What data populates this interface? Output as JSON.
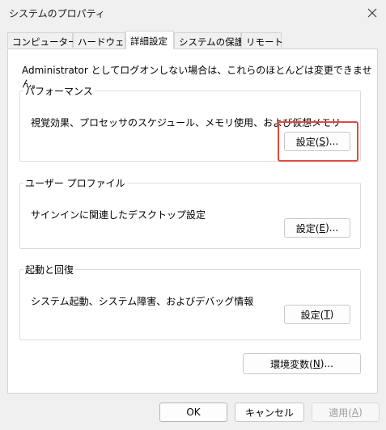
{
  "window": {
    "title": "システムのプロパティ"
  },
  "tabs": [
    {
      "label": "コンピューター名",
      "active": false
    },
    {
      "label": "ハードウェア",
      "active": false
    },
    {
      "label": "詳細設定",
      "active": true
    },
    {
      "label": "システムの保護",
      "active": false
    },
    {
      "label": "リモート",
      "active": false
    }
  ],
  "note": "Administrator としてログオンしない場合は、これらのほとんどは変更できません。",
  "performance": {
    "title": "パフォーマンス",
    "description": "視覚効果、プロセッサのスケジュール、メモリ使用、および仮想メモリ",
    "button": {
      "prefix": "設定(",
      "mnemonic": "S",
      "suffix": ")..."
    }
  },
  "user_profile": {
    "title": "ユーザー プロファイル",
    "description": "サインインに関連したデスクトップ設定",
    "button": {
      "prefix": "設定(",
      "mnemonic": "E",
      "suffix": ")..."
    }
  },
  "startup": {
    "title": "起動と回復",
    "description": "システム起動、システム障害、およびデバッグ情報",
    "button": {
      "prefix": "設定(",
      "mnemonic": "T",
      "suffix": ")"
    }
  },
  "env_button": {
    "prefix": "環境変数(",
    "mnemonic": "N",
    "suffix": ")..."
  },
  "footer": {
    "ok": "OK",
    "cancel": "キャンセル",
    "apply": {
      "prefix": "適用(",
      "mnemonic": "A",
      "suffix": ")"
    }
  },
  "colors": {
    "highlight": "#e04a3f"
  }
}
